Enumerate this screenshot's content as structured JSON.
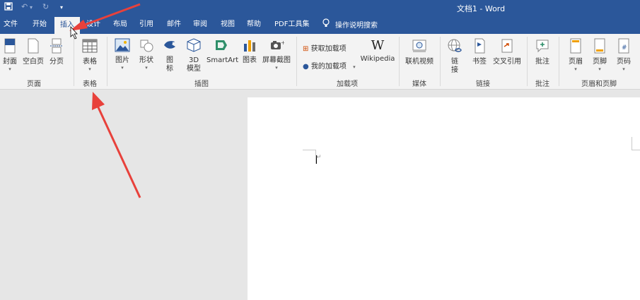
{
  "window": {
    "title": "文档1 - Word"
  },
  "quick_access": {
    "save_icon": "save-icon",
    "undo_icon": "undo-icon",
    "redo_icon": "redo-icon",
    "customize_icon": "customize-icon"
  },
  "tabs": [
    {
      "label": "文件"
    },
    {
      "label": "开始"
    },
    {
      "label": "插入",
      "active": true
    },
    {
      "label": "设计"
    },
    {
      "label": "布局"
    },
    {
      "label": "引用"
    },
    {
      "label": "邮件"
    },
    {
      "label": "审阅"
    },
    {
      "label": "视图"
    },
    {
      "label": "帮助"
    },
    {
      "label": "PDF工具集"
    }
  ],
  "tell_me": {
    "label": "操作说明搜索"
  },
  "ribbon": {
    "pages": {
      "label": "页面",
      "cover": "封面",
      "blank": "空白页",
      "break": "分页"
    },
    "tables": {
      "label": "表格",
      "table": "表格"
    },
    "illustrations": {
      "label": "插图",
      "pictures": "图片",
      "shapes": "形状",
      "icons_l1": "图",
      "icons_l2": "标",
      "models_l1": "3D",
      "models_l2": "模型",
      "smartart": "SmartArt",
      "chart": "图表",
      "screenshot": "屏幕截图"
    },
    "addins": {
      "label": "加载项",
      "get": "获取加载项",
      "my": "我的加载项",
      "wikipedia": "Wikipedia",
      "wiki_glyph": "W"
    },
    "media": {
      "label": "媒体",
      "online_video": "联机视频"
    },
    "links": {
      "label": "链接",
      "link_l1": "链",
      "link_l2": "接",
      "bookmark": "书签",
      "cross_ref": "交叉引用"
    },
    "comments": {
      "label": "批注",
      "comment": "批注"
    },
    "header_footer": {
      "label": "页眉和页脚",
      "header": "页眉",
      "footer": "页脚",
      "page_number": "页码"
    }
  },
  "document": {
    "paragraph_mark": "↵"
  },
  "annotation_color": "#e8413b",
  "accent": "#2b579a"
}
